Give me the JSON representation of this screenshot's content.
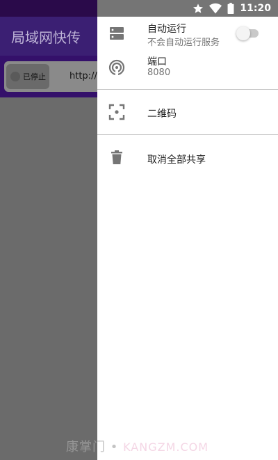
{
  "status_bar": {
    "time": "11:20",
    "icons": [
      "star-icon",
      "wifi-icon",
      "battery-icon"
    ],
    "color": "#757575"
  },
  "app": {
    "title": "局域网快传",
    "server": {
      "status_label": "已停止",
      "url_preview": "http://"
    }
  },
  "drawer": {
    "auto_run": {
      "icon": "server-icon",
      "title": "自动运行",
      "subtitle": "不会自动运行服务",
      "enabled": false
    },
    "port": {
      "icon": "antenna-icon",
      "title": "端口",
      "value": "8080"
    },
    "qr_code": {
      "icon": "qr-scan-icon",
      "title": "二维码"
    },
    "cancel_share": {
      "icon": "trash-icon",
      "title": "取消全部共享"
    }
  },
  "watermark": {
    "cn": "康掌门",
    "sep": "•",
    "latin": "KANGZM.COM"
  },
  "colors": {
    "primary": "#3b1f73",
    "primary_dark": "#2a0a4a",
    "scrim": "#6b6b6b",
    "icon": "#757575"
  }
}
